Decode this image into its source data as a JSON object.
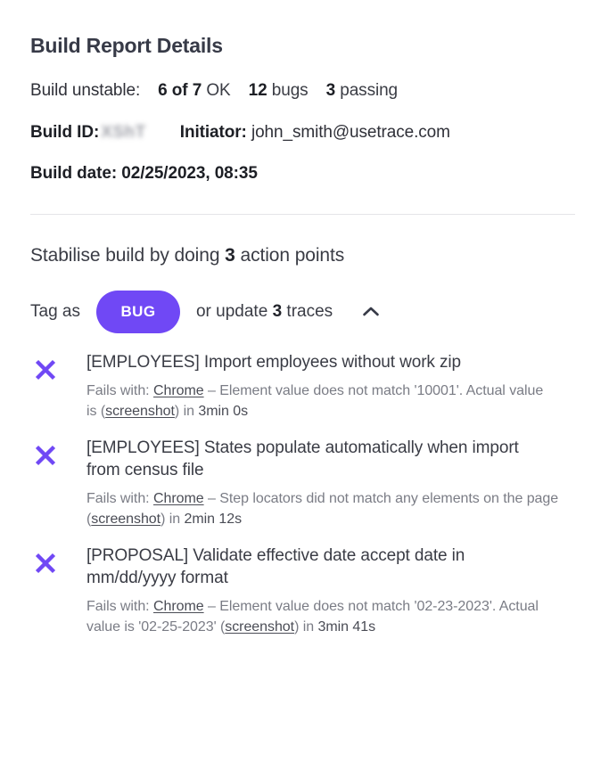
{
  "card": {
    "title": "Build Report Details"
  },
  "summary": {
    "label": "Build unstable:",
    "stats": [
      {
        "value": "6 of 7",
        "unit": "OK"
      },
      {
        "value": "12",
        "unit": "bugs"
      },
      {
        "value": "3",
        "unit": "passing"
      }
    ]
  },
  "meta": {
    "build_id_label": "Build ID:",
    "build_id_value": "XShT",
    "initiator_label": "Initiator:",
    "initiator_value": "john_smith@usetrace.com",
    "build_date_label": "Build date:",
    "build_date_value": "02/25/2023, 08:35"
  },
  "stabilise": {
    "prefix": "Stabilise build by doing",
    "count": "3",
    "suffix": "action points",
    "tag_as_label": "Tag as",
    "bug_button_label": "BUG",
    "update_prefix": "or update",
    "update_count": "3",
    "update_suffix": "traces",
    "collapse_icon": "chevron-up-icon"
  },
  "failures": [
    {
      "status_icon": "x-icon",
      "title": "[EMPLOYEES] Import employees without work zip",
      "detail_prefix": "Fails with:",
      "browser": "Chrome",
      "message_before": "– Element value does not match '10001'. Actual value is (",
      "screenshot_link": "screenshot",
      "message_after": ") in",
      "duration": "3min 0s"
    },
    {
      "status_icon": "x-icon",
      "title": "[EMPLOYEES] States populate automatically when import from census file",
      "detail_prefix": "Fails with:",
      "browser": "Chrome",
      "message_before": "– Step locators did not match any elements on the page (",
      "screenshot_link": "screenshot",
      "message_after": ") in",
      "duration": "2min 12s"
    },
    {
      "status_icon": "x-icon",
      "title": "[PROPOSAL] Validate effective date accept date in mm/dd/yyyy format",
      "detail_prefix": "Fails with:",
      "browser": "Chrome",
      "message_before": "– Element value does not match '02-23-2023'. Actual value is '02-25-2023' (",
      "screenshot_link": "screenshot",
      "message_after": ") in",
      "duration": "3min 41s"
    }
  ],
  "colors": {
    "accent_purple": "#7048f5",
    "title_dark": "#373a47",
    "body_gray": "#7a7c85",
    "divider": "#e4e4e8"
  }
}
